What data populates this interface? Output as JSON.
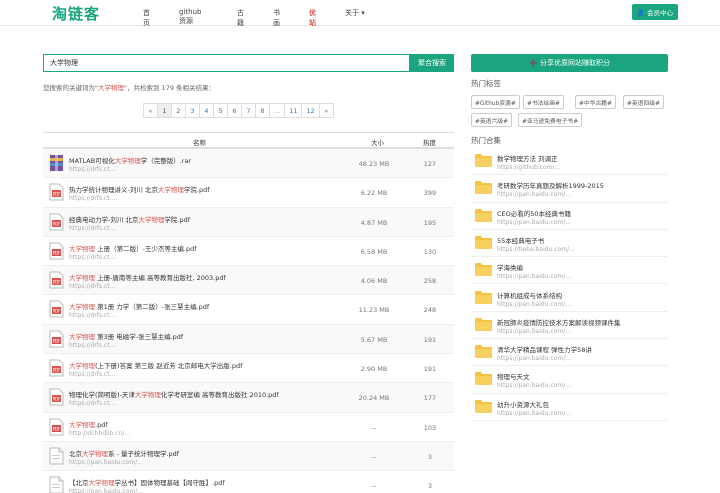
{
  "header": {
    "logo": "淘链客",
    "nav": [
      "首页",
      "github资源",
      "古籍",
      "书画",
      "优站",
      "关于 ▾"
    ],
    "member_button": "👤 会员中心"
  },
  "search": {
    "value": "大学物理",
    "button": "聚合搜索",
    "result_prefix": "您搜索的关键词为\"",
    "keyword": "大学物理",
    "result_suffix": "\"，共检索到 179 条相关结果："
  },
  "pagination": [
    "«",
    "1",
    "2",
    "3",
    "4",
    "5",
    "6",
    "7",
    "8",
    "...",
    "11",
    "12",
    "»"
  ],
  "table": {
    "headers": {
      "name": "名称",
      "size": "大小",
      "heat": "热度"
    },
    "rows": [
      {
        "icon": "rar-file-icon",
        "pre": "MATLAB可视化",
        "kw": "大学物理",
        "post": "学（完整版）.rar",
        "url": "https://drfs.ct...",
        "size": "48.23 MB",
        "heat": "127"
      },
      {
        "icon": "pdf-file-icon",
        "pre": "热力学统计物理讲义-刘川 北京",
        "kw": "大学物理",
        "post": "学院.pdf",
        "url": "https://drfs.ct...",
        "size": "6.22 MB",
        "heat": "399"
      },
      {
        "icon": "pdf-file-icon",
        "pre": "经典电动力学-刘川 北京",
        "kw": "大学物理",
        "post": "学院.pdf",
        "url": "https://drfs.ct...",
        "size": "4.87 MB",
        "heat": "195"
      },
      {
        "icon": "pdf-file-icon",
        "pre": "",
        "kw": "大学物理",
        "post": " 上册（第二版）-王少杰等主编.pdf",
        "url": "https://drfs.ct...",
        "size": "6.58 MB",
        "heat": "130"
      },
      {
        "icon": "pdf-file-icon",
        "pre": "",
        "kw": "大学物理",
        "post": " 上册-唐南等主编 高等教育出版社, 2003.pdf",
        "url": "https://drfs.ct...",
        "size": "4.06 MB",
        "heat": "258"
      },
      {
        "icon": "pdf-file-icon",
        "pre": "",
        "kw": "大学物理",
        "post": " 第1册 力学（第二版）-张三慧主编.pdf",
        "url": "https://drfs.ct...",
        "size": "11.23 MB",
        "heat": "248"
      },
      {
        "icon": "pdf-file-icon",
        "pre": "",
        "kw": "大学物理",
        "post": " 第3册 电磁学-张三慧主编.pdf",
        "url": "https://drfs.ct...",
        "size": "5.67 MB",
        "heat": "191"
      },
      {
        "icon": "pdf-file-icon",
        "pre": "",
        "kw": "大学物理",
        "post": "(上下册)答案 第三版 赵近芳 北京邮电大学出版.pdf",
        "url": "https://drfs.ct...",
        "size": "2.90 MB",
        "heat": "191"
      },
      {
        "icon": "pdf-file-icon",
        "pre": "物理化学(简明版)-天津",
        "kw": "大学物理",
        "post": "化学考研室编 高等教育出版社 2010.pdf",
        "url": "https://drfs.ct...",
        "size": "20.24 MB",
        "heat": "177"
      },
      {
        "icon": "pdf-file-icon",
        "pre": "",
        "kw": "大学物理",
        "post": ".pdf",
        "url": "http://dl.hbdlib.cn/...",
        "size": "--",
        "heat": "103"
      },
      {
        "icon": "file-icon",
        "pre": "北京",
        "kw": "大学物理",
        "post": "系 - 量子统计物理学.pdf",
        "url": "https://pan.baidu.com/...",
        "size": "--",
        "heat": "3"
      },
      {
        "icon": "file-icon",
        "pre": "【北京",
        "kw": "大学物理",
        "post": "学丛书】固体物理基础【阎守胜】.pdf",
        "url": "https://pan.baidu.com/...",
        "size": "--",
        "heat": "3"
      }
    ]
  },
  "sidebar": {
    "share_button": "➕ 分享优质网站赚取积分",
    "tags_heading": "热门标签",
    "tags": [
      "#Github资源#",
      "#书法绘画#",
      "#中华古籍#",
      "#英语四级#",
      "#英语六级#",
      "#亚马逊免费电子书#"
    ],
    "collections_heading": "热门合集",
    "collections": [
      {
        "title": "数学物理方法 刘调正",
        "url": "https://github.com/..."
      },
      {
        "title": "考研数学历年真题及解析1999-2015",
        "url": "https://pan.baidu.com/..."
      },
      {
        "title": "CEO必看的50本经典书籍",
        "url": "https://pan.baidu.com/..."
      },
      {
        "title": "55本经典电子书",
        "url": "https://tieba.baidu.com/..."
      },
      {
        "title": "学海类编",
        "url": "https://pan.baidu.com/..."
      },
      {
        "title": "计算机组成与体系结构",
        "url": "https://pan.baidu.com/..."
      },
      {
        "title": "新冠肺炎疫情防控技术方案解读视频课件集",
        "url": "https://pan.baidu.com/..."
      },
      {
        "title": "清华大学精品课程 弹性力学58讲",
        "url": "https://pan.baidu.com/..."
      },
      {
        "title": "物理与天文",
        "url": "https://pan.baidu.com/..."
      },
      {
        "title": "幼升小资源大礼包",
        "url": "https://pan.baidu.com/..."
      }
    ]
  },
  "colors": {
    "accent": "#1aa57e",
    "keyword": "#d9534f",
    "folder": "#f5c342"
  }
}
